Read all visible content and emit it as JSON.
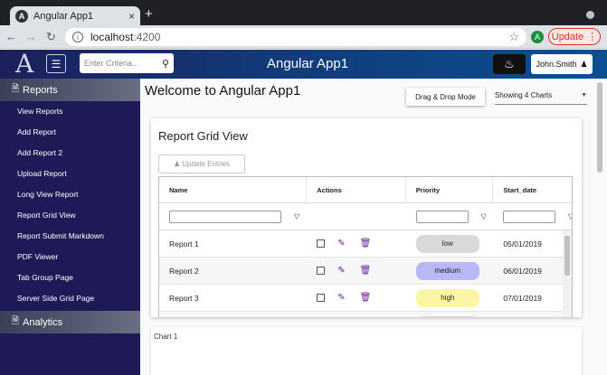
{
  "browser": {
    "tab_title": "Angular App1",
    "tab_favicon": "A",
    "tab_close": "×",
    "new_tab": "+",
    "url_host": "localhost",
    "url_port": ":4200",
    "profile_initial": "A",
    "update_label": "Update"
  },
  "header": {
    "logo": "A",
    "search_placeholder": "Enter Criteria...",
    "title": "Angular App1",
    "user_label": "John.Smith",
    "gradient_start": "#1c1f5c",
    "gradient_end": "#0c4f91"
  },
  "sidebar": {
    "background": "#1e1a57",
    "reports_section": "Reports",
    "items": [
      "View Reports",
      "Add Report",
      "Add Report 2",
      "Upload Report",
      "Long View Report",
      "Report Grid View",
      "Report Submit Markdown",
      "PDF Viewer",
      "Tab Group Page",
      "Server Side Grid Page"
    ],
    "analytics_section": "Analytics"
  },
  "main": {
    "welcome": "Welcome to Angular App1",
    "drag_drop_label": "Drag & Drop Mode",
    "charts_selected": "Showing 4 Charts"
  },
  "grid_card": {
    "title": "Report Grid View",
    "update_label": "Update Entries",
    "columns": [
      "Name",
      "Actions",
      "Priority",
      "Start_date"
    ],
    "rows": [
      {
        "name": "Report 1",
        "priority": "low",
        "priority_color": "#d9d9d9",
        "start_date": "05/01/2019"
      },
      {
        "name": "Report 2",
        "priority": "medium",
        "priority_color": "#b8b8f5",
        "start_date": "06/01/2019"
      },
      {
        "name": "Report 3",
        "priority": "high",
        "priority_color": "#fbf6a6",
        "start_date": "07/01/2019"
      }
    ]
  },
  "chart_card": {
    "title": "Chart 1"
  }
}
